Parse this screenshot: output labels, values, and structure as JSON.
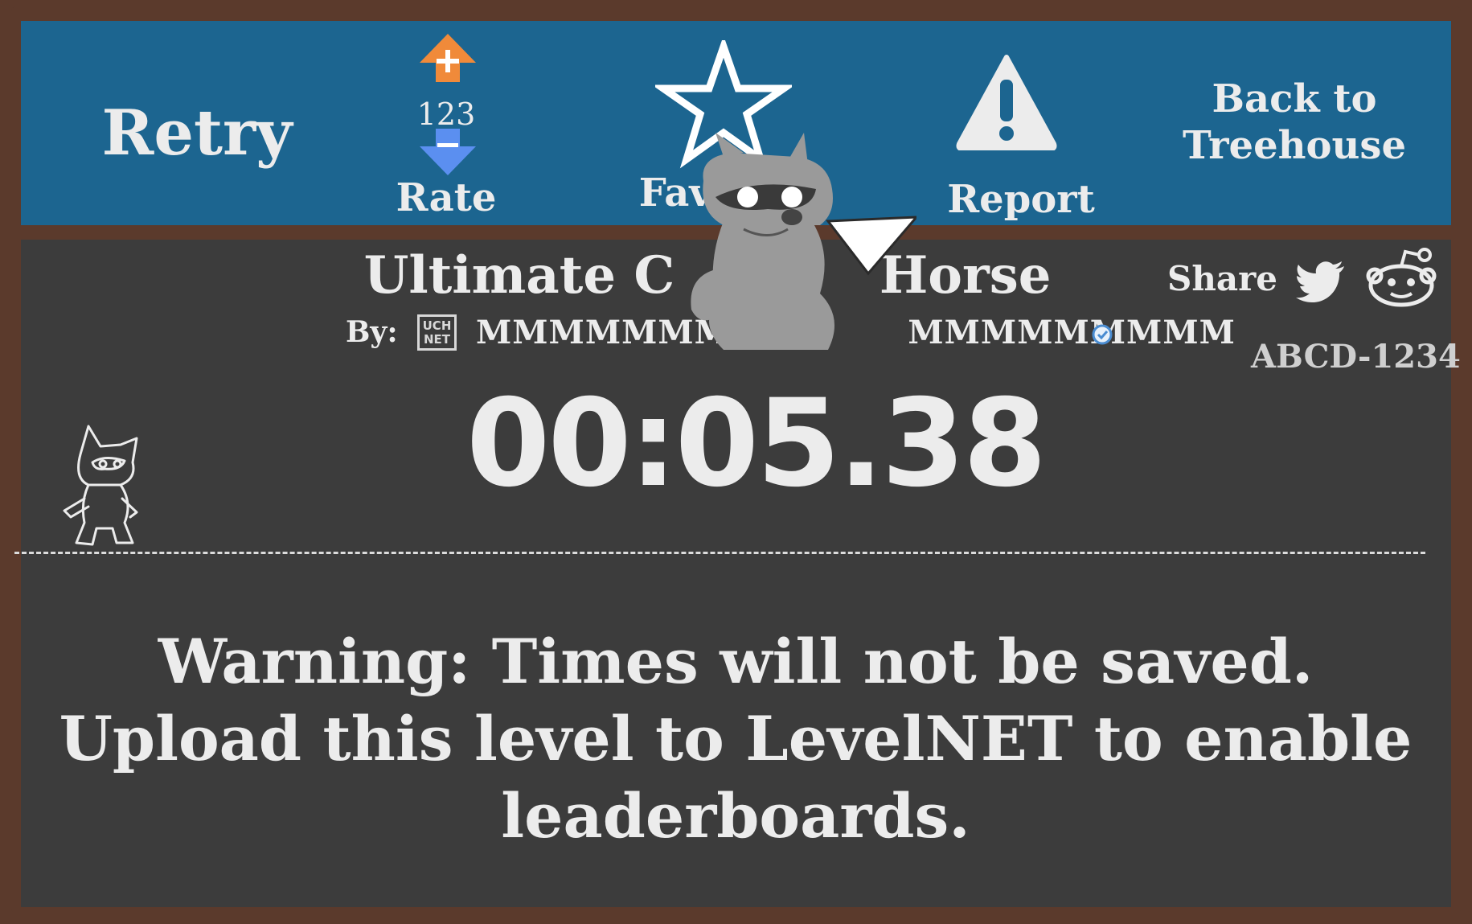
{
  "toolbar": {
    "retry_label": "Retry",
    "rate_count": "123",
    "rate_label": "Rate",
    "favorite_label": "Fav",
    "report_label": "Report",
    "back_label_line1": "Back to",
    "back_label_line2": "Treehouse"
  },
  "level": {
    "title": "Ultimate C",
    "title_end": "Horse",
    "by_label": "By:",
    "author": "MMMMMMMMM",
    "author_end": "MMMMMMMMM",
    "code": "ABCD-1234",
    "verified_icon": "verified-check-icon"
  },
  "share": {
    "label": "Share",
    "icons": [
      "twitter-icon",
      "reddit-icon"
    ]
  },
  "run": {
    "time": "00:05.38"
  },
  "warning": {
    "line1": "Warning: Times will not be saved.",
    "line2": "Upload this level to LevelNET to enable",
    "line3": "leaderboards."
  },
  "colors": {
    "toolbar": "#1c6590",
    "panel": "#3c3c3c",
    "frame": "#5b3a2c",
    "upvote": "#f08a3a",
    "downvote": "#5b8ff0",
    "text": "#ececec"
  }
}
